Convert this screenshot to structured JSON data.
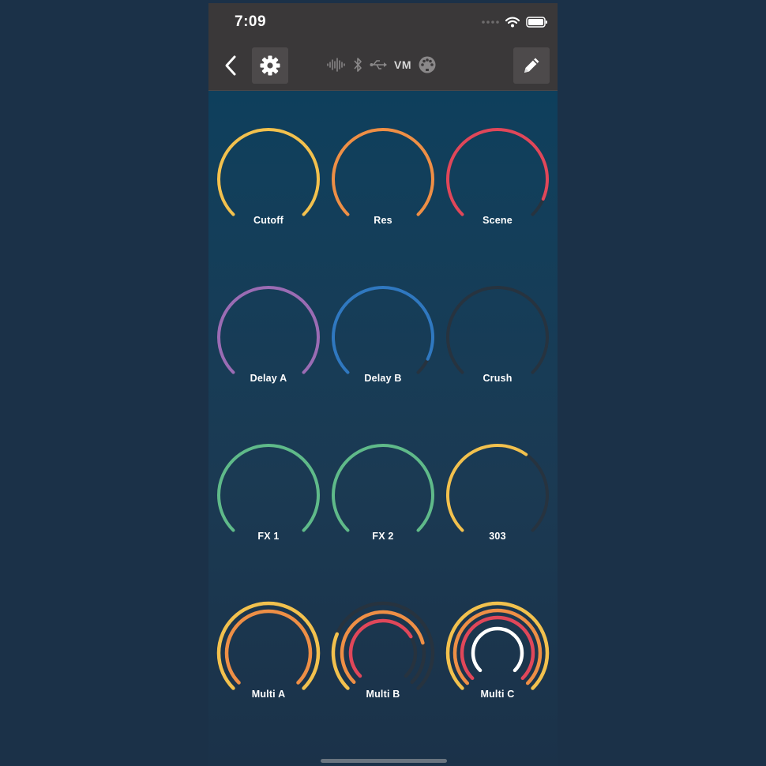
{
  "status_bar": {
    "time": "7:09"
  },
  "toolbar": {
    "connection_label": "VM",
    "icons": [
      "back-chevron-icon",
      "gear-icon",
      "audio-waveform-icon",
      "bluetooth-icon",
      "usb-icon",
      "midi-din-icon",
      "pencil-icon"
    ]
  },
  "colors": {
    "yellow": "#f2c14e",
    "orange": "#ee8f46",
    "red": "#e0475a",
    "purple": "#9a6cb4",
    "blue": "#2f78c0",
    "green": "#5fba8a",
    "track": "#27333f",
    "white": "#ffffff"
  },
  "knobs": [
    {
      "label": "Cutoff",
      "rings": [
        {
          "color": "yellow",
          "value": 1.0
        }
      ]
    },
    {
      "label": "Res",
      "rings": [
        {
          "color": "orange",
          "value": 1.0
        }
      ]
    },
    {
      "label": "Scene",
      "rings": [
        {
          "color": "red",
          "value": 0.92
        }
      ]
    },
    {
      "label": "Delay A",
      "rings": [
        {
          "color": "purple",
          "value": 1.0
        }
      ]
    },
    {
      "label": "Delay B",
      "rings": [
        {
          "color": "blue",
          "value": 0.93
        }
      ]
    },
    {
      "label": "Crush",
      "rings": [
        {
          "color": "track",
          "value": 0.0
        }
      ]
    },
    {
      "label": "FX 1",
      "rings": [
        {
          "color": "green",
          "value": 1.0
        }
      ]
    },
    {
      "label": "FX 2",
      "rings": [
        {
          "color": "green",
          "value": 1.0
        }
      ]
    },
    {
      "label": "303",
      "rings": [
        {
          "color": "yellow",
          "value": 0.63
        }
      ]
    },
    {
      "label": "Multi A",
      "rings": [
        {
          "color": "yellow",
          "value": 1.0
        },
        {
          "color": "orange",
          "value": 1.0
        }
      ]
    },
    {
      "label": "Multi B",
      "rings": [
        {
          "color": "yellow",
          "value": 0.25
        },
        {
          "color": "orange",
          "value": 0.78
        },
        {
          "color": "red",
          "value": 0.72
        }
      ]
    },
    {
      "label": "Multi C",
      "rings": [
        {
          "color": "yellow",
          "value": 1.0
        },
        {
          "color": "orange",
          "value": 1.0
        },
        {
          "color": "red",
          "value": 1.0
        },
        {
          "color": "white",
          "value": 1.0
        }
      ]
    }
  ]
}
